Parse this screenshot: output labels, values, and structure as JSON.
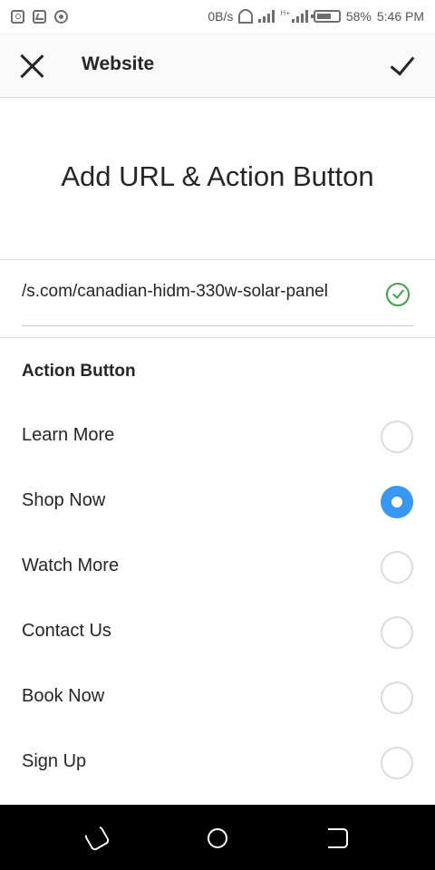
{
  "status_bar": {
    "left_icons": [
      "instagram-icon",
      "gallery-icon",
      "target-icon"
    ],
    "network_speed": "0B/s",
    "network_type": "H+",
    "battery_percent": "58%",
    "time": "5:46 PM"
  },
  "header": {
    "close_icon": "close-icon",
    "title": "Website",
    "confirm_icon": "checkmark-icon"
  },
  "main": {
    "heading": "Add URL & Action Button",
    "url_value": "s.com/canadian-hidm-330w-solar-panel/",
    "url_valid_icon": "check-circle-icon",
    "section_label": "Action Button",
    "options": [
      {
        "label": "Learn More",
        "selected": false
      },
      {
        "label": "Shop Now",
        "selected": true
      },
      {
        "label": "Watch More",
        "selected": false
      },
      {
        "label": "Contact Us",
        "selected": false
      },
      {
        "label": "Book Now",
        "selected": false
      },
      {
        "label": "Sign Up",
        "selected": false
      }
    ]
  },
  "colors": {
    "accent": "#3897f0",
    "valid": "#3ea34a",
    "text": "#262626",
    "divider": "#dbdbdb"
  },
  "nav_bar": {
    "buttons": [
      "recent-apps-icon",
      "home-icon",
      "back-icon"
    ]
  }
}
